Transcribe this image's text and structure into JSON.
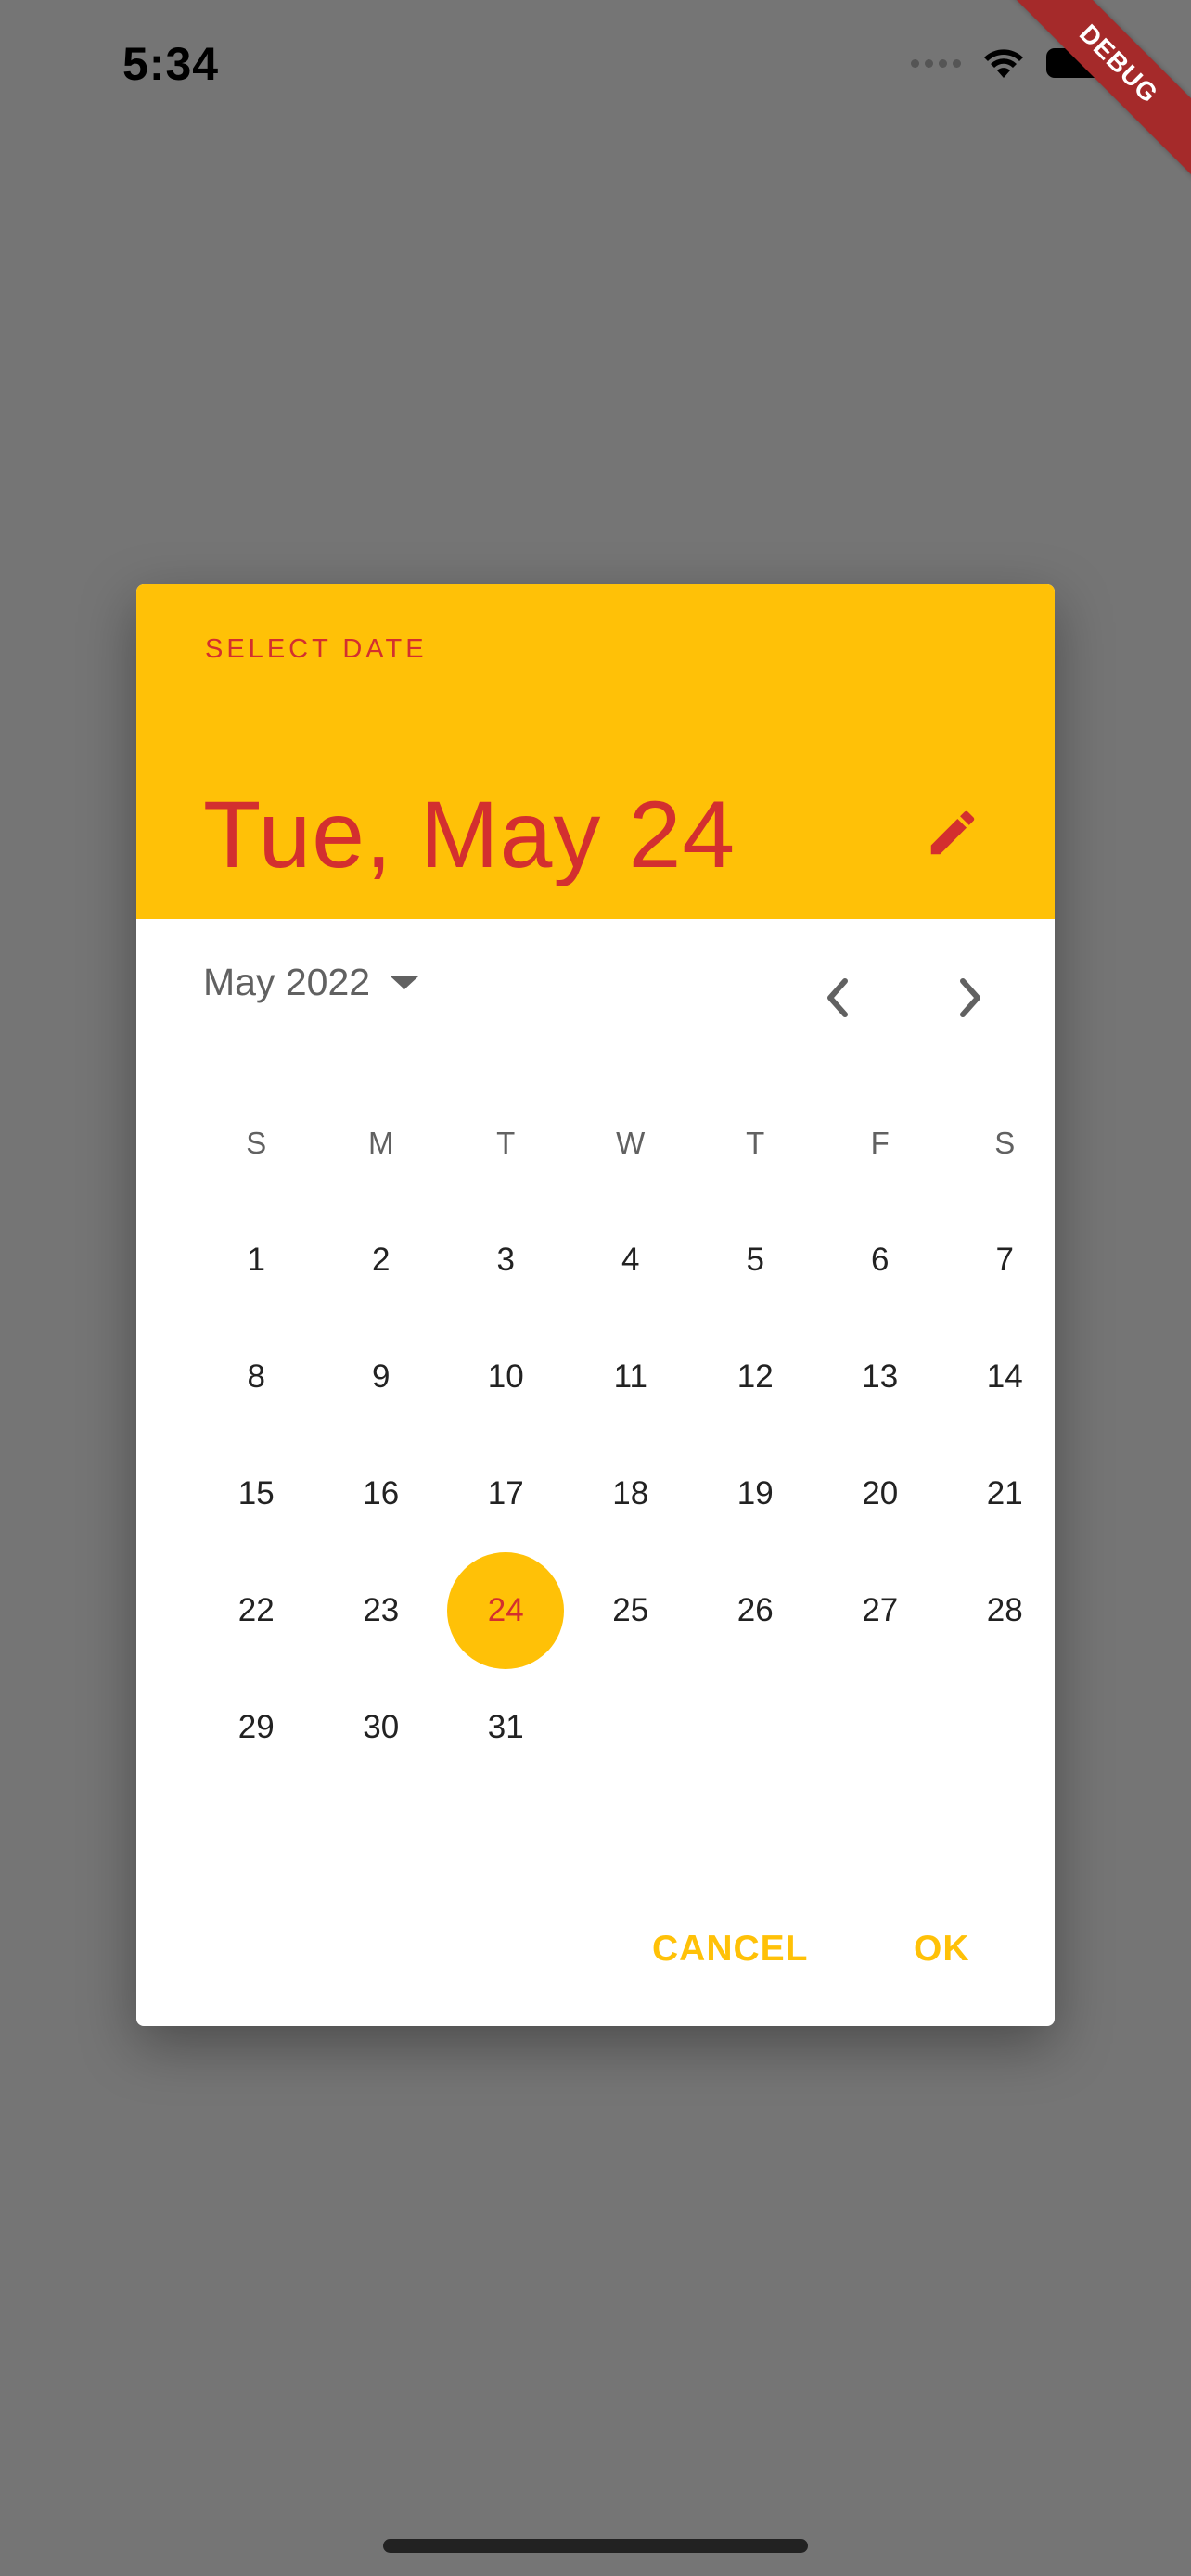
{
  "status_bar": {
    "time": "5:34"
  },
  "debug_banner": {
    "label": "DEBUG",
    "color": "#a52a2a"
  },
  "dialog": {
    "header": {
      "help_text": "SELECT DATE",
      "selected_date": "Tue, May 24",
      "edit_icon": "pencil-icon",
      "background_color": "#ffc107",
      "text_color": "#d32f2f"
    },
    "month_selector": {
      "label": "May 2022",
      "dropdown_icon": "dropdown-arrow-icon",
      "prev_icon": "chevron-left-icon",
      "next_icon": "chevron-right-icon"
    },
    "weekdays": [
      "S",
      "M",
      "T",
      "W",
      "T",
      "F",
      "S"
    ],
    "days": [
      "1",
      "2",
      "3",
      "4",
      "5",
      "6",
      "7",
      "8",
      "9",
      "10",
      "11",
      "12",
      "13",
      "14",
      "15",
      "16",
      "17",
      "18",
      "19",
      "20",
      "21",
      "22",
      "23",
      "24",
      "25",
      "26",
      "27",
      "28",
      "29",
      "30",
      "31"
    ],
    "selected_day": "24",
    "actions": {
      "cancel_label": "CANCEL",
      "ok_label": "OK",
      "color": "#ffc107"
    }
  }
}
